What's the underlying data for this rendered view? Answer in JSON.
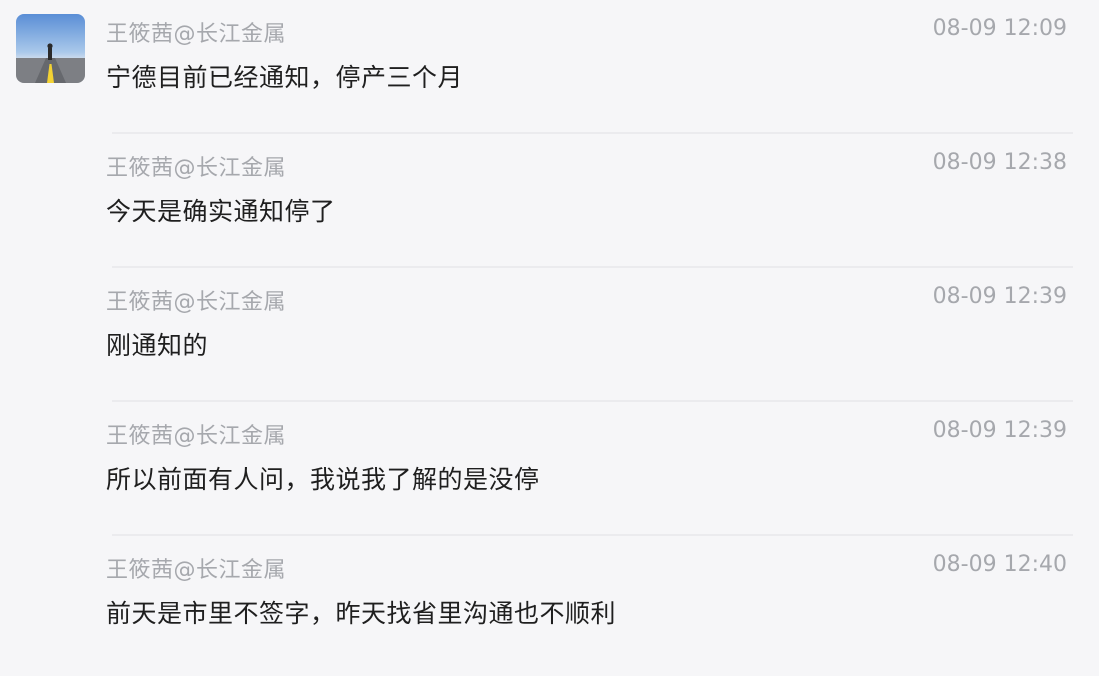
{
  "messages": [
    {
      "sender": "王筱茜@长江金属",
      "time": "08-09 12:09",
      "text": "宁德目前已经通知，停产三个月"
    },
    {
      "sender": "王筱茜@长江金属",
      "time": "08-09 12:38",
      "text": "今天是确实通知停了"
    },
    {
      "sender": "王筱茜@长江金属",
      "time": "08-09 12:39",
      "text": "刚通知的"
    },
    {
      "sender": "王筱茜@长江金属",
      "time": "08-09 12:39",
      "text": "所以前面有人问，我说我了解的是没停"
    },
    {
      "sender": "王筱茜@长江金属",
      "time": "08-09 12:40",
      "text": "前天是市里不签字，昨天找省里沟通也不顺利"
    }
  ],
  "colors": {
    "background": "#f6f6f8",
    "meta_text": "#a6a8ad",
    "message_text": "#1f1f1f",
    "divider": "#ebebee"
  }
}
